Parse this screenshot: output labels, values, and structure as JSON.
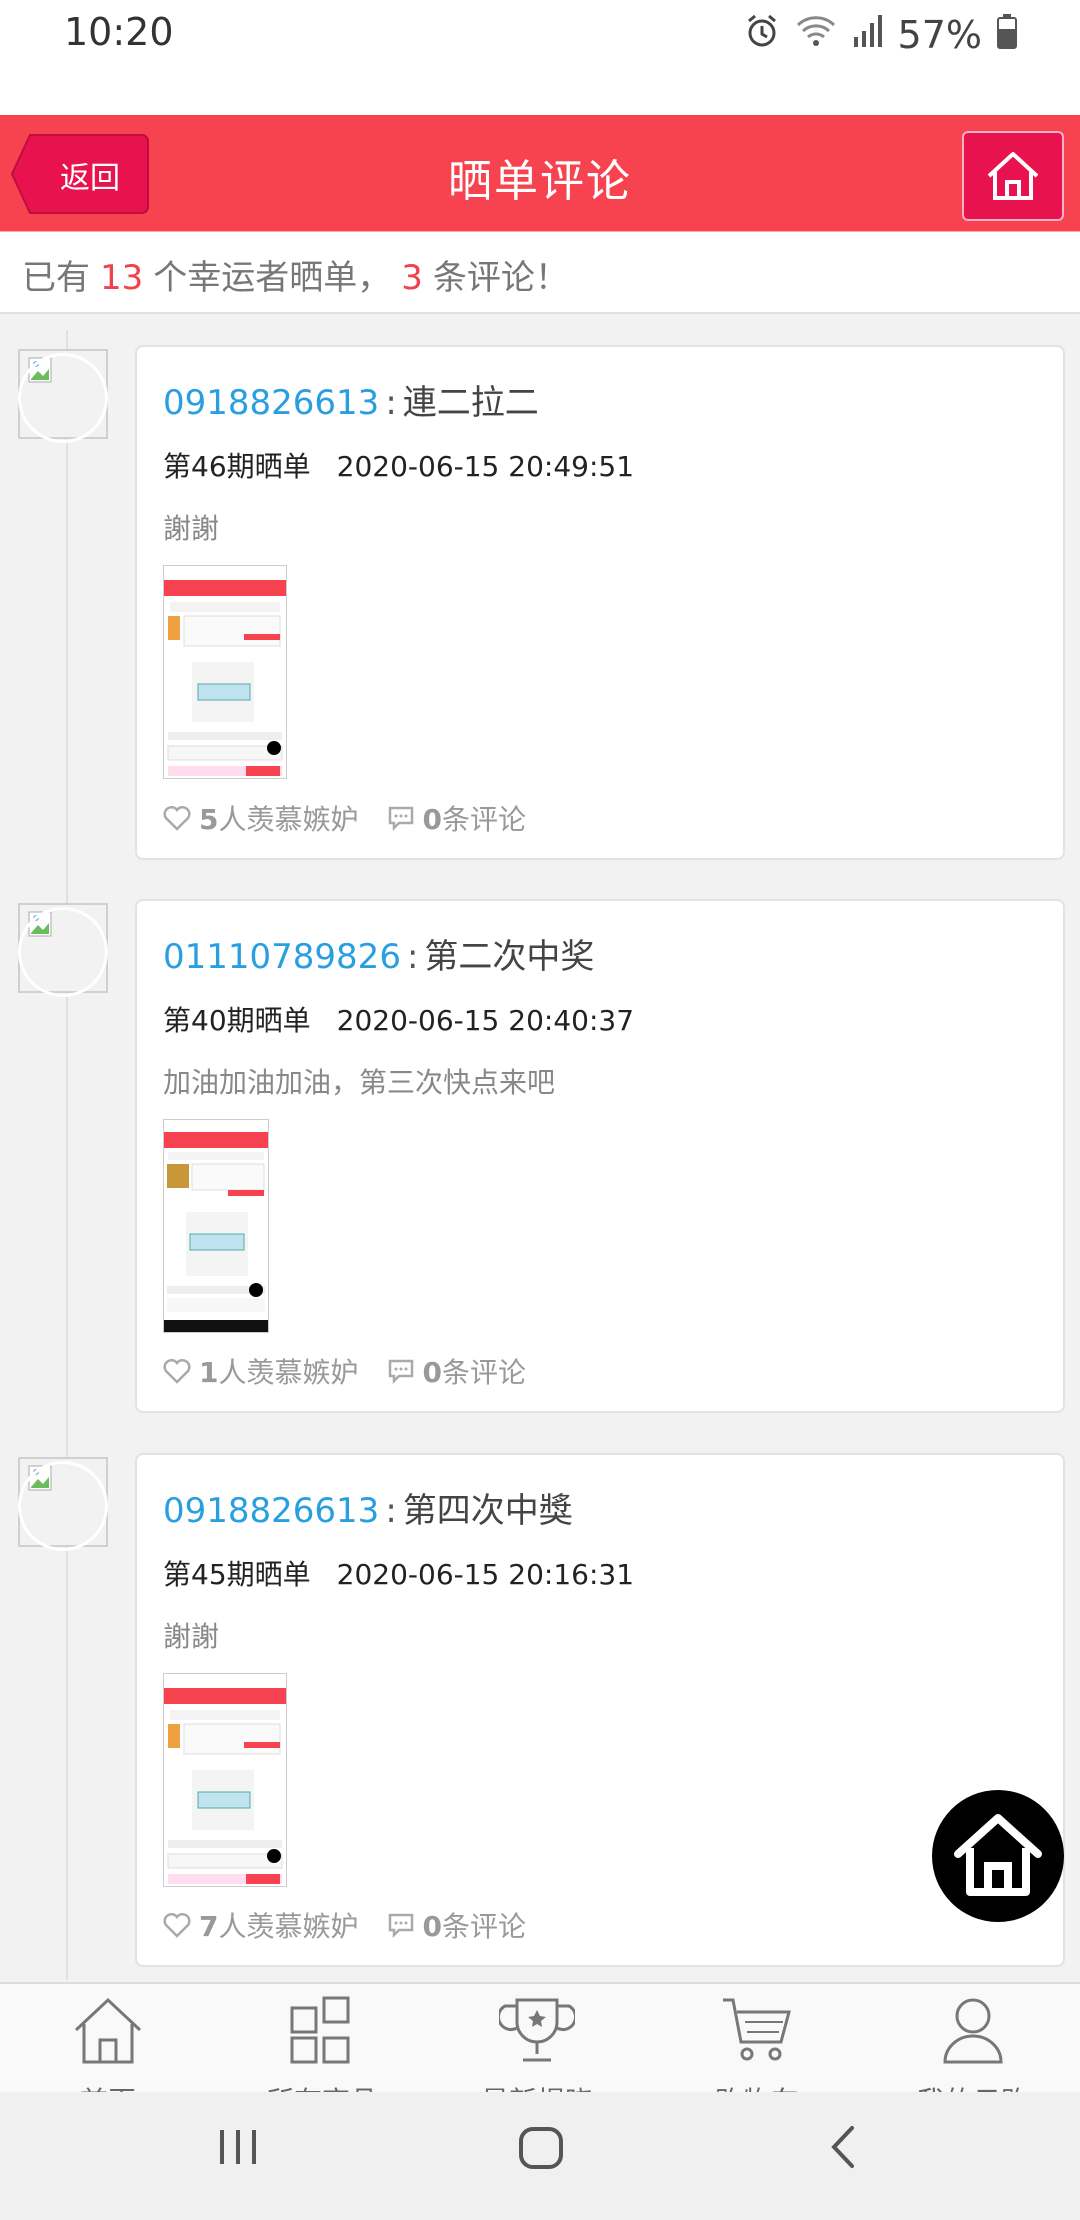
{
  "status_bar": {
    "time": "10:20",
    "battery": "57%",
    "icons": [
      "alarm-icon",
      "wifi-icon",
      "signal-icon",
      "battery-icon"
    ]
  },
  "header": {
    "back_label": "返回",
    "title": "晒单评论",
    "home_icon": "home-icon"
  },
  "summary": {
    "prefix": "已有",
    "winners_count": "13",
    "middle": "个幸运者晒单，",
    "comments_count": "3",
    "suffix": "条评论！"
  },
  "entries": [
    {
      "user": "0918826613",
      "separator": ":",
      "title": "連二拉二",
      "period": "第46期晒单",
      "date": "2020-06-15 20:49:51",
      "comment": "謝謝",
      "likes_count": "5",
      "likes_label": "人羡慕嫉妒",
      "comments_count": "0",
      "comments_label": "条评论"
    },
    {
      "user": "01110789826",
      "separator": ":",
      "title": "第二次中奖",
      "period": "第40期晒单",
      "date": "2020-06-15 20:40:37",
      "comment": "加油加油加油，第三次快点来吧",
      "likes_count": "1",
      "likes_label": "人羡慕嫉妒",
      "comments_count": "0",
      "comments_label": "条评论"
    },
    {
      "user": "0918826613",
      "separator": ":",
      "title": "第四次中獎",
      "period": "第45期晒单",
      "date": "2020-06-15 20:16:31",
      "comment": "謝謝",
      "likes_count": "7",
      "likes_label": "人羡慕嫉妒",
      "comments_count": "0",
      "comments_label": "条评论"
    }
  ],
  "tabbar": [
    {
      "label": "首页",
      "icon": "home-icon"
    },
    {
      "label": "所有商品",
      "icon": "grid-icon"
    },
    {
      "label": "最新揭晓",
      "icon": "trophy-icon"
    },
    {
      "label": "购物车",
      "icon": "cart-icon"
    },
    {
      "label": "我的云购",
      "icon": "user-icon"
    }
  ],
  "navbar": {
    "icons": [
      "recents-icon",
      "home-circle-icon",
      "back-icon"
    ]
  },
  "colors": {
    "header": "#f7434f",
    "accent_red": "#f0414d",
    "user_blue": "#2a9fe0",
    "home_button": "#e8124e"
  }
}
